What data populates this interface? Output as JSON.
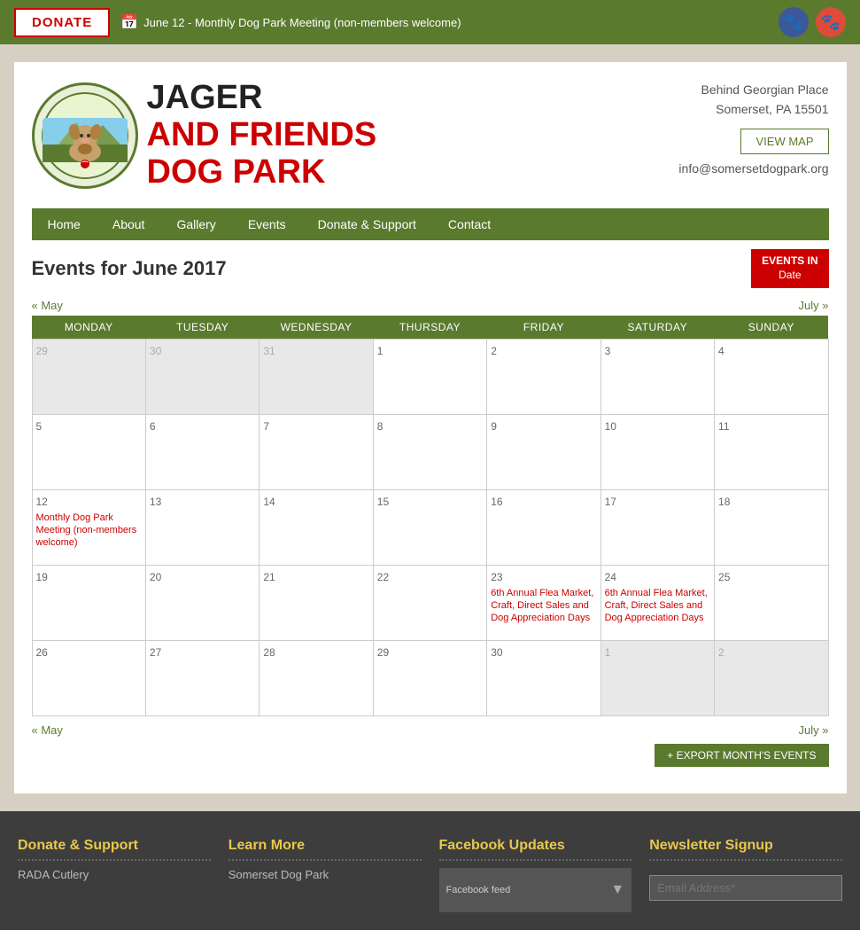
{
  "topbar": {
    "donate_label": "DONATE",
    "event_text": "June 12 - Monthly Dog Park Meeting (non-members welcome)",
    "fb_icon": "f",
    "gplus_icon": "g+"
  },
  "header": {
    "site_name_line1": "JAGER",
    "site_name_line2": "AND FRIENDS",
    "site_name_line3": "DOG PARK",
    "address_line1": "Behind Georgian Place",
    "address_line2": "Somerset, PA 15501",
    "view_map": "VIEW MAP",
    "email": "info@somersetdogpark.org"
  },
  "nav": {
    "items": [
      "Home",
      "About",
      "Gallery",
      "Events",
      "Donate & Support",
      "Contact"
    ]
  },
  "calendar": {
    "title": "Events for June 2017",
    "badge_top": "EVENTS IN",
    "badge_bot": "Date",
    "prev_label": "« May",
    "next_label": "July »",
    "days": [
      "MONDAY",
      "TUESDAY",
      "WEDNESDAY",
      "THURSDAY",
      "FRIDAY",
      "SATURDAY",
      "SUNDAY"
    ],
    "rows": [
      [
        {
          "num": "29",
          "other": true,
          "events": []
        },
        {
          "num": "30",
          "other": true,
          "events": []
        },
        {
          "num": "31",
          "other": true,
          "events": []
        },
        {
          "num": "1",
          "other": false,
          "events": []
        },
        {
          "num": "2",
          "other": false,
          "events": []
        },
        {
          "num": "3",
          "other": false,
          "events": []
        },
        {
          "num": "4",
          "other": false,
          "events": []
        }
      ],
      [
        {
          "num": "5",
          "other": false,
          "events": []
        },
        {
          "num": "6",
          "other": false,
          "events": []
        },
        {
          "num": "7",
          "other": false,
          "events": []
        },
        {
          "num": "8",
          "other": false,
          "events": []
        },
        {
          "num": "9",
          "other": false,
          "events": []
        },
        {
          "num": "10",
          "other": false,
          "events": []
        },
        {
          "num": "11",
          "other": false,
          "events": []
        }
      ],
      [
        {
          "num": "12",
          "other": false,
          "events": [
            "Monthly Dog Park Meeting (non-members welcome)"
          ]
        },
        {
          "num": "13",
          "other": false,
          "events": []
        },
        {
          "num": "14",
          "other": false,
          "events": []
        },
        {
          "num": "15",
          "other": false,
          "events": []
        },
        {
          "num": "16",
          "other": false,
          "events": []
        },
        {
          "num": "17",
          "other": false,
          "events": []
        },
        {
          "num": "18",
          "other": false,
          "events": []
        }
      ],
      [
        {
          "num": "19",
          "other": false,
          "events": []
        },
        {
          "num": "20",
          "other": false,
          "events": []
        },
        {
          "num": "21",
          "other": false,
          "events": []
        },
        {
          "num": "22",
          "other": false,
          "events": []
        },
        {
          "num": "23",
          "other": false,
          "events": [
            "6th Annual Flea Market, Craft, Direct Sales and Dog Appreciation Days"
          ]
        },
        {
          "num": "24",
          "other": false,
          "events": [
            "6th Annual Flea Market, Craft, Direct Sales and Dog Appreciation Days"
          ]
        },
        {
          "num": "25",
          "other": false,
          "events": []
        }
      ],
      [
        {
          "num": "26",
          "other": false,
          "events": []
        },
        {
          "num": "27",
          "other": false,
          "events": []
        },
        {
          "num": "28",
          "other": false,
          "events": []
        },
        {
          "num": "29",
          "other": false,
          "events": []
        },
        {
          "num": "30",
          "other": false,
          "events": []
        },
        {
          "num": "1",
          "other": true,
          "events": []
        },
        {
          "num": "2",
          "other": true,
          "events": []
        }
      ]
    ],
    "export_label": "+ EXPORT MONTH'S EVENTS"
  },
  "footer": {
    "col1_title": "Donate & Support",
    "col1_item": "RADA Cutlery",
    "col2_title": "Learn More",
    "col2_item": "Somerset Dog Park",
    "col3_title": "Facebook Updates",
    "col4_title": "Newsletter Signup",
    "email_placeholder": "Email Address*"
  }
}
